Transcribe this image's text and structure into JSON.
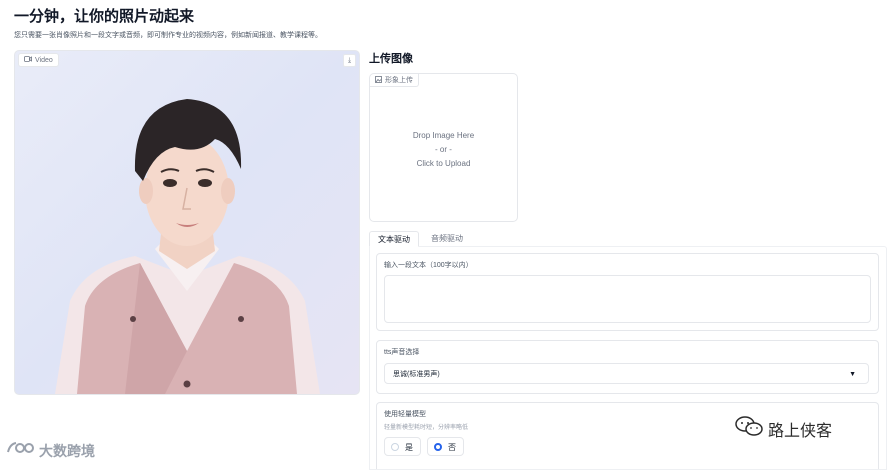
{
  "header": {
    "title": "一分钟，让你的照片动起来",
    "subtitle": "您只需要一张肖像照片和一段文字或音频，即可制作专业的视频内容，例如新闻报道、教学课程等。"
  },
  "video": {
    "label": "Video",
    "icon": "video-camera-icon",
    "download_icon": "download-icon"
  },
  "upload": {
    "title": "上传图像",
    "label": "形象上传",
    "drop_line1": "Drop Image Here",
    "drop_line2": "- or -",
    "drop_line3": "Click to Upload"
  },
  "tabs": [
    {
      "label": "文本驱动",
      "active": true
    },
    {
      "label": "音频驱动",
      "active": false
    }
  ],
  "text_input": {
    "label": "输入一段文本（100字以内）",
    "value": ""
  },
  "tts": {
    "label": "tts声音选择",
    "selected": "思诚(标准男声)"
  },
  "light_model": {
    "label": "使用轻量模型",
    "hint": "轻量新模型耗时短，分辨率略低",
    "options": [
      {
        "label": "是",
        "checked": false
      },
      {
        "label": "否",
        "checked": true
      }
    ]
  },
  "watermarks": {
    "left": "大数跨境",
    "right": "路上侠客"
  },
  "colors": {
    "accent": "#2563eb",
    "border": "#e5e7eb",
    "text_muted": "#6b7280"
  }
}
